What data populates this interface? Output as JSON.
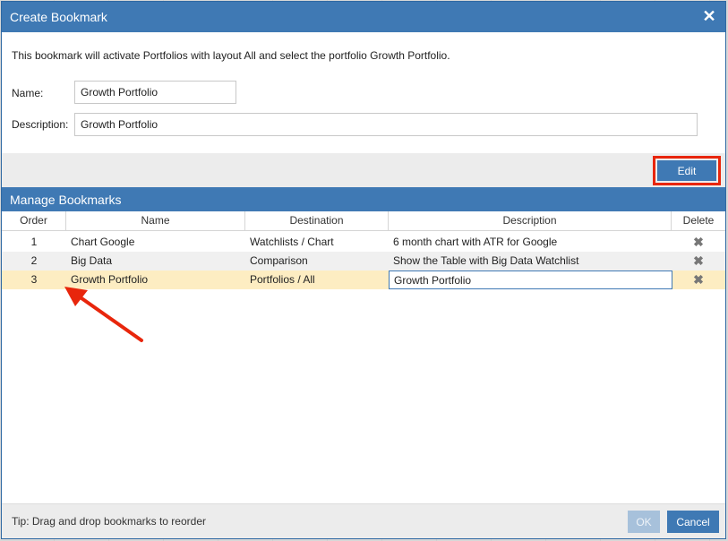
{
  "dialog": {
    "title": "Create Bookmark",
    "close_icon": "close-icon",
    "info_text": "This bookmark will activate Portfolios with layout All and select the portfolio Growth Portfolio.",
    "name_label": "Name:",
    "name_value": "Growth Portfolio",
    "description_label": "Description:",
    "description_value": "Growth Portfolio",
    "edit_label": "Edit"
  },
  "manage": {
    "title": "Manage Bookmarks",
    "columns": {
      "order": "Order",
      "name": "Name",
      "destination": "Destination",
      "description": "Description",
      "delete": "Delete"
    },
    "rows": [
      {
        "order": "1",
        "name": "Chart Google",
        "destination": "Watchlists / Chart",
        "description": "6 month chart with ATR for Google"
      },
      {
        "order": "2",
        "name": "Big Data",
        "destination": "Comparison",
        "description": "Show the Table with Big Data Watchlist"
      },
      {
        "order": "3",
        "name": "Growth Portfolio",
        "destination": "Portfolios / All",
        "description": "Growth Portfolio"
      }
    ],
    "selected_row": 3,
    "delete_icon": "delete-x-icon"
  },
  "footer": {
    "tip": "Tip: Drag and drop bookmarks to reorder",
    "ok_label": "OK",
    "ok_enabled": false,
    "cancel_label": "Cancel"
  },
  "colors": {
    "accent": "#3f79b4",
    "selected_row": "#fdedc2",
    "highlight_annotation": "#e8260c"
  }
}
